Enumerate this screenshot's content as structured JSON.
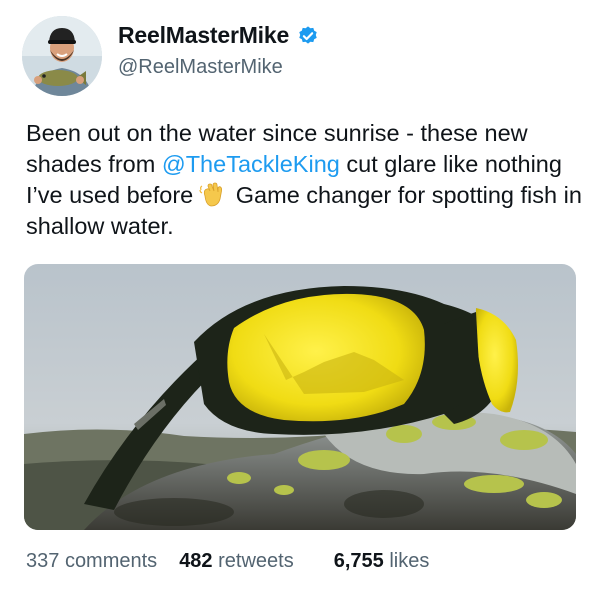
{
  "author": {
    "display_name": "ReelMasterMike",
    "handle": "@ReelMasterMike",
    "verified": true,
    "verified_color": "#1d9bf0",
    "avatar_icon": "fisherman-avatar"
  },
  "tweet": {
    "text_before": "Been out on the water since sunrise - these new shades from ",
    "mention": "@TheTackleKing",
    "text_mid": " cut glare like nothing I’ve used before",
    "emoji": "waving-hand-emoji",
    "text_after": " Game changer for spotting fish in shallow water.",
    "mention_color": "#1d9bf0"
  },
  "media": {
    "icon": "sunglasses-on-rock-photo",
    "lens_color": "#f2e11c",
    "frame_color": "#1d2419"
  },
  "stats": {
    "comments_count": "337",
    "comments_label": "comments",
    "retweets_count": "482",
    "retweets_label": "retweets",
    "likes_count": "6,755",
    "likes_label": "likes"
  }
}
